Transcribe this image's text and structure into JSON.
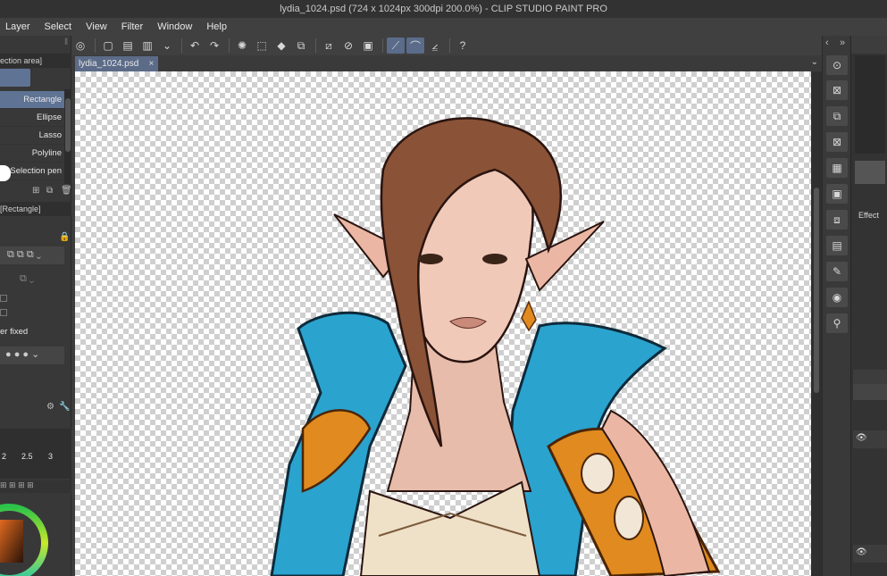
{
  "window": {
    "title": "lydia_1024.psd (724 x 1024px 300dpi 200.0%) - CLIP STUDIO PAINT PRO"
  },
  "menu": [
    "Layer",
    "Select",
    "View",
    "Filter",
    "Window",
    "Help"
  ],
  "document": {
    "tab_label": "lydia_1024.psd",
    "close_glyph": "×"
  },
  "left_panel": {
    "tool_tab": "ection area]",
    "subtools": [
      "Rectangle",
      "Ellipse",
      "Lasso",
      "Polyline",
      "Selection pen"
    ],
    "selected_subtool": "Rectangle",
    "property_tab": "[Rectangle]",
    "fixed_label": "er fixed",
    "ruler_values": [
      "2",
      "2.5",
      "3"
    ]
  },
  "right_panel": {
    "effect_label": "Effect",
    "nav_left": "‹",
    "nav_right": "»"
  },
  "colors": {
    "accent": "#5f7394",
    "skin": "#f0c9b8",
    "hair": "#8a5236",
    "collar": "#2aa3cf",
    "gold": "#e08a1f"
  },
  "icons": [
    "cmd-icon",
    "undo-icon",
    "redo-icon",
    "rotate-icon",
    "eye-icon",
    "lock-icon",
    "trash-icon"
  ]
}
